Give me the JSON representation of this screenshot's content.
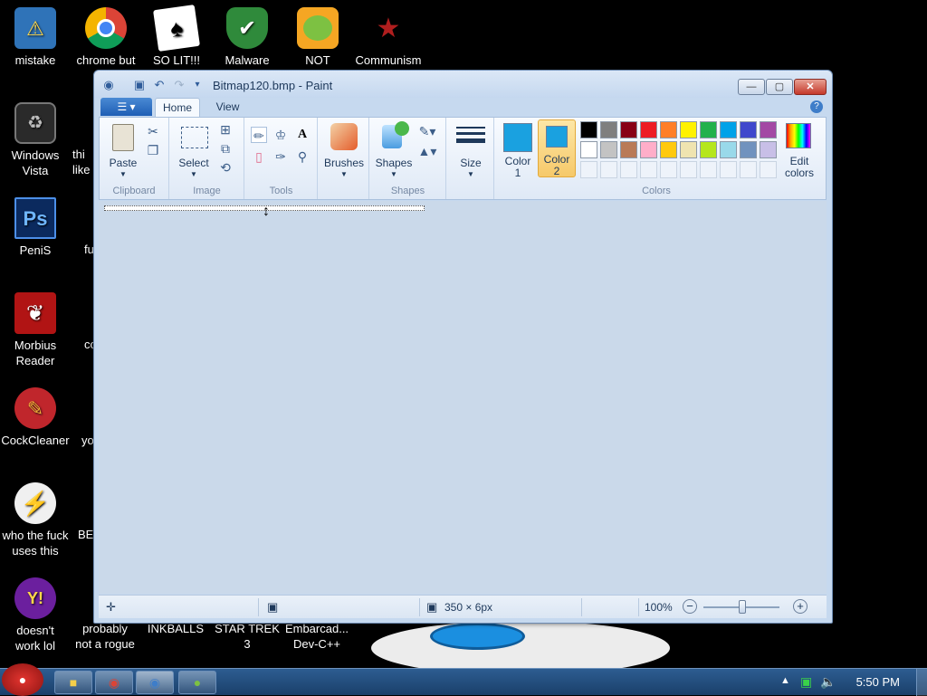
{
  "desktop_icons": [
    {
      "label": "mistake",
      "glyph": "⚠",
      "color": "#2f73b8"
    },
    {
      "label": "Windows\nVista",
      "glyph": "●",
      "color": "#333333"
    },
    {
      "label": "PeniS",
      "glyph": "Ps",
      "color": "#0b2a5e"
    },
    {
      "label": "Morbius\nReader",
      "glyph": "❦",
      "color": "#b11414"
    },
    {
      "label": "CockCleaner",
      "glyph": "✎",
      "color": "#c0262c"
    },
    {
      "label": "who the fuck\nuses this",
      "glyph": "⚡",
      "color": "#f0f0f0"
    },
    {
      "label": "doesn't\nwork lol",
      "glyph": "Y!",
      "color": "#6b1f9e"
    }
  ],
  "top_icons": [
    {
      "label": "chrome but\nno",
      "glyph": "◉",
      "color": "#1a73e8"
    },
    {
      "label": "SO LIT!!!",
      "glyph": "♠",
      "color": "#ffffff"
    },
    {
      "label": "Malware",
      "glyph": "✔",
      "color": "#2f8a3b"
    },
    {
      "label": "NOT PISSED",
      "glyph": "●",
      "color": "#f5a623"
    },
    {
      "label": "Communism",
      "glyph": "★",
      "color": "#9b1c1c"
    }
  ],
  "peek_labels": [
    "thi",
    "like",
    "fu",
    "co",
    "yo",
    "BE"
  ],
  "bottom_icons": [
    "probably\nnot a rogue",
    "INKBALLS",
    "STAR TREK\n3",
    "Embarcad...\nDev-C++"
  ],
  "window": {
    "title": "Bitmap120.bmp - Paint",
    "tabs": {
      "home": "Home",
      "view": "View"
    },
    "help": "?",
    "groups": {
      "clipboard": "Clipboard",
      "image": "Image",
      "tools": "Tools",
      "shapes": "Shapes",
      "colors": "Colors"
    },
    "buttons": {
      "paste": "Paste",
      "select": "Select",
      "brushes": "Brushes",
      "shapes": "Shapes",
      "size": "Size",
      "color1": "Color\n1",
      "color2": "Color\n2",
      "edit_colors": "Edit\ncolors"
    },
    "color1": "#1aa1e0",
    "color2": "#1aa1e0",
    "palette_row1": [
      "#000000",
      "#7f7f7f",
      "#880015",
      "#ed1c24",
      "#ff7f27",
      "#fff200",
      "#22b14c",
      "#00a2e8",
      "#3f48cc",
      "#a349a4"
    ],
    "palette_row2": [
      "#ffffff",
      "#c3c3c3",
      "#b97a57",
      "#ffaec9",
      "#ffc90e",
      "#efe4b0",
      "#b5e61d",
      "#99d9ea",
      "#7092be",
      "#c8bfe7"
    ],
    "status": {
      "dimensions": "350 × 6px",
      "zoom": "100%"
    }
  },
  "taskbar": {
    "clock": "5:50 PM"
  }
}
